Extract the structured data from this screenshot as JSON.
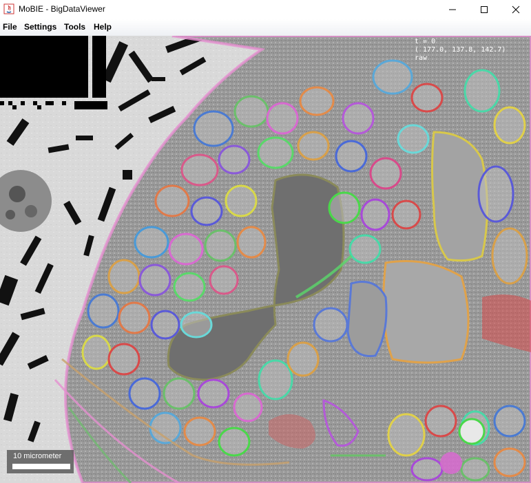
{
  "window": {
    "title": "MoBIE - BigDataViewer"
  },
  "menu": {
    "items": [
      "File",
      "Settings",
      "Tools",
      "Help"
    ]
  },
  "viewer": {
    "timepoint": "t = 0",
    "coordinates": "( 177.0, 137.8, 142.7)",
    "source_name": "raw",
    "scalebar_label": "10 micrometer"
  },
  "icons": {
    "app": "java-icon",
    "minimize": "minimize-icon",
    "maximize": "maximize-icon",
    "close": "close-icon"
  }
}
